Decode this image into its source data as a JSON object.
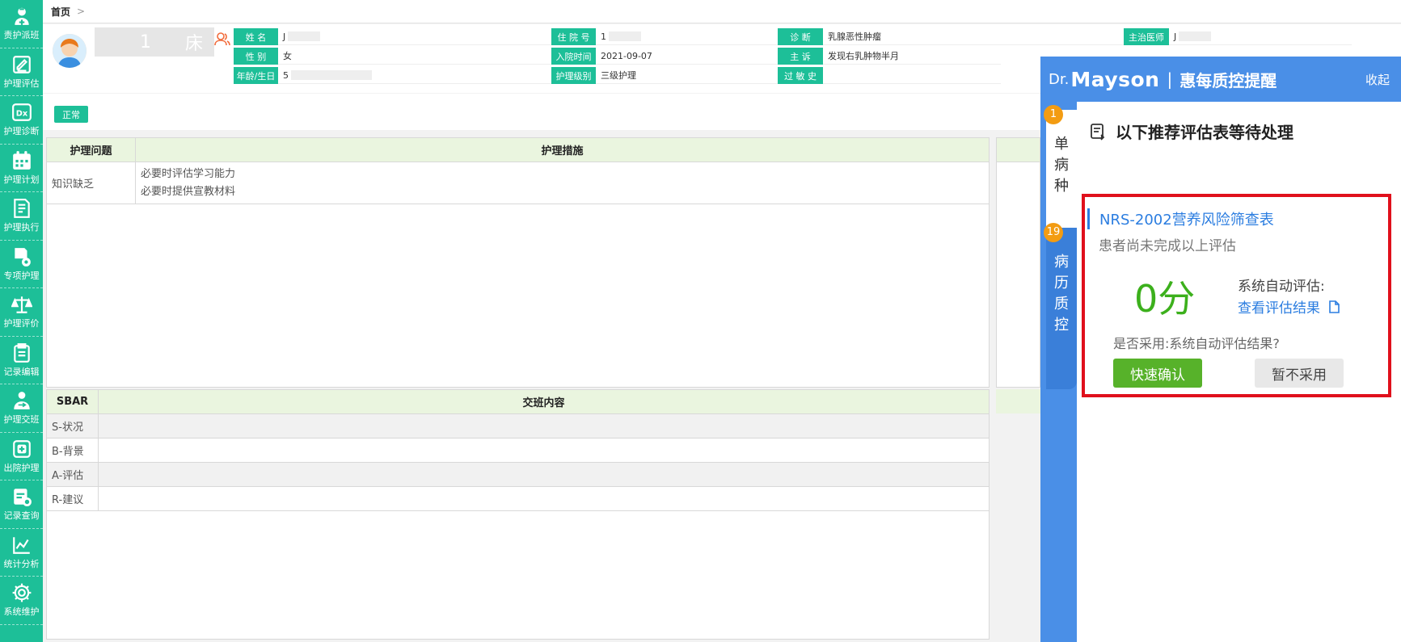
{
  "nav": [
    {
      "label": "责护派班",
      "icon": "nurse-icon"
    },
    {
      "label": "护理评估",
      "icon": "edit-form-icon"
    },
    {
      "label": "护理诊断",
      "icon": "dx-icon"
    },
    {
      "label": "护理计划",
      "icon": "calendar-icon"
    },
    {
      "label": "护理执行",
      "icon": "execute-icon"
    },
    {
      "label": "专项护理",
      "icon": "special-care-icon"
    },
    {
      "label": "护理评价",
      "icon": "scale-icon"
    },
    {
      "label": "记录编辑",
      "icon": "clipboard-icon"
    },
    {
      "label": "护理交班",
      "icon": "handover-icon"
    },
    {
      "label": "出院护理",
      "icon": "discharge-icon"
    },
    {
      "label": "记录查询",
      "icon": "record-query-icon"
    },
    {
      "label": "统计分析",
      "icon": "chart-icon"
    },
    {
      "label": "系统维护",
      "icon": "gear-icon"
    }
  ],
  "breadcrumb": {
    "home": "首页",
    "sep": ">"
  },
  "patient": {
    "bed_number": "1",
    "bed_word": "床",
    "name_label": "姓  名",
    "name_value": "J",
    "gender_label": "性  别",
    "gender_value": "女",
    "age_label": "年龄/生日",
    "age_value": "5",
    "admission_no_label": "住 院 号",
    "admission_no_value": "1",
    "admit_time_label": "入院时间",
    "admit_time_value": "2021-09-07",
    "care_level_label": "护理级别",
    "care_level_value": "三级护理",
    "diagnosis_label": "诊  断",
    "diagnosis_value": "乳腺恶性肿瘤",
    "complaint_label": "主  诉",
    "complaint_value": "发现右乳肿物半月",
    "allergy_label": "过 敏 史",
    "allergy_value": "",
    "doctor_label": "主治医师",
    "doctor_value": "J"
  },
  "status": {
    "label": "正常"
  },
  "care_table": {
    "headers": [
      "护理问题",
      "护理措施"
    ],
    "rows": [
      {
        "problem": "知识缺乏",
        "measures": [
          "必要时评估学习能力",
          "必要时提供宣教材料"
        ]
      }
    ]
  },
  "sbar_table": {
    "headers": [
      "SBAR",
      "交班内容"
    ],
    "rows": [
      "S-状况",
      "B-背景",
      "A-评估",
      "R-建议"
    ]
  },
  "assistant": {
    "dr": "Dr.",
    "brand": "Mayson",
    "bar": "|",
    "title": "惠每质控提醒",
    "collapse": "收起",
    "tab_single": {
      "badge": "1",
      "chars": [
        "单",
        "病",
        "种"
      ]
    },
    "tab_record": {
      "badge": "19",
      "chars": [
        "病",
        "历",
        "质",
        "控"
      ]
    },
    "heading": "以下推荐评估表等待处理",
    "card": {
      "title": "NRS-2002营养风险筛查表",
      "subtitle": "患者尚未完成以上评估",
      "score": "0分",
      "auto_label": "系统自动评估:",
      "view_link": "查看评估结果",
      "adopt_question": "是否采用:系统自动评估结果?",
      "confirm": "快速确认",
      "reject": "暂不采用"
    }
  }
}
